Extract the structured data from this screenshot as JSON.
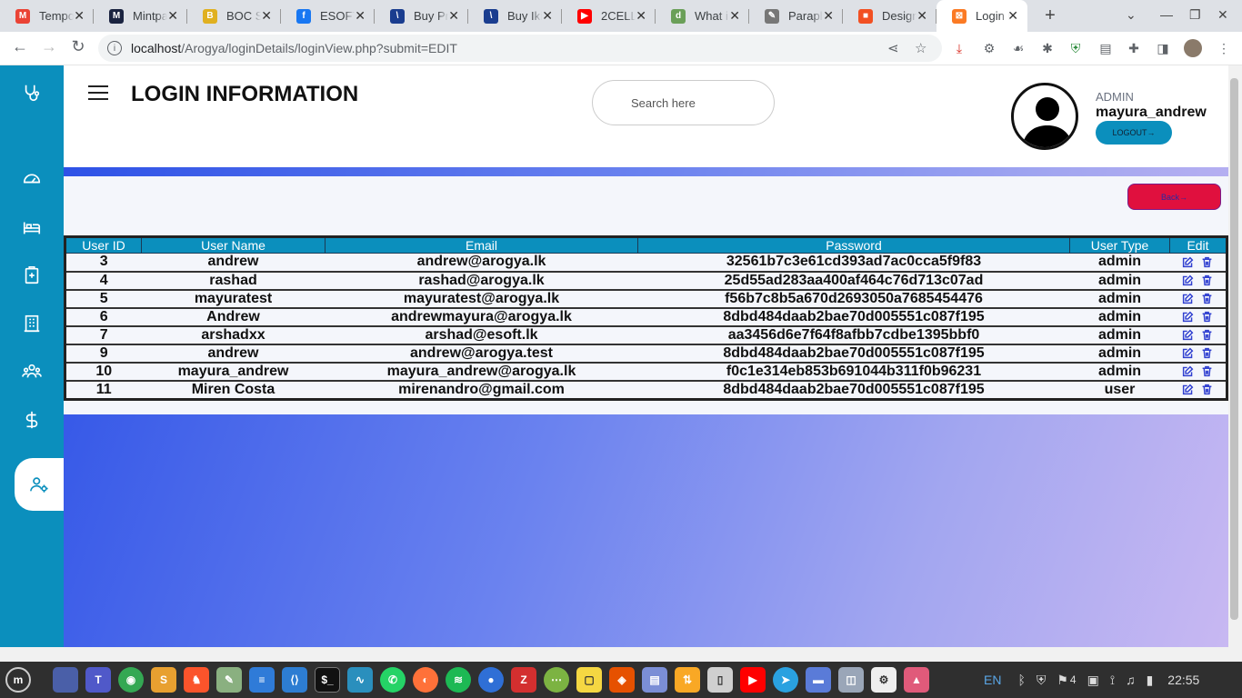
{
  "browser": {
    "tabs": [
      {
        "title": "Tempo",
        "icon": "gmail-icon",
        "color": "#ea4335",
        "glyph": "M"
      },
      {
        "title": "Mintpa",
        "icon": "mintpay-icon",
        "color": "#1a2340",
        "glyph": "M"
      },
      {
        "title": "BOC Sr",
        "icon": "boc-icon",
        "color": "#e0b020",
        "glyph": "B"
      },
      {
        "title": "ESOFT",
        "icon": "facebook-icon",
        "color": "#1877f2",
        "glyph": "f"
      },
      {
        "title": "Buy Pr",
        "icon": "store-icon",
        "color": "#1a3d8f",
        "glyph": "\\"
      },
      {
        "title": "Buy Iki",
        "icon": "store-icon",
        "color": "#1a3d8f",
        "glyph": "\\"
      },
      {
        "title": "2CELL",
        "icon": "youtube-icon",
        "color": "#ff0000",
        "glyph": "▶"
      },
      {
        "title": "What i",
        "icon": "d-icon",
        "color": "#6a9f58",
        "glyph": "d"
      },
      {
        "title": "Parapl",
        "icon": "pen-icon",
        "color": "#777",
        "glyph": "✎"
      },
      {
        "title": "Design",
        "icon": "microsoft-icon",
        "color": "#f25022",
        "glyph": "■"
      },
      {
        "title": "Login I",
        "icon": "xampp-icon",
        "color": "#fb7a24",
        "glyph": "⊠",
        "active": true
      }
    ],
    "url_host": "localhost",
    "url_path": "/Arogya/loginDetails/loginView.php?submit=EDIT"
  },
  "header": {
    "title": "LOGIN INFORMATION",
    "search_placeholder": "Search here",
    "role": "ADMIN",
    "username": "mayura_andrew",
    "logout_label": "LOGOUT→"
  },
  "back_label": "Back→",
  "table": {
    "columns": [
      "User ID",
      "User Name",
      "Email",
      "Password",
      "User Type",
      "Edit"
    ],
    "rows": [
      [
        "3",
        "andrew",
        "andrew@arogya.lk",
        "32561b7c3e61cd393ad7ac0cca5f9f83",
        "admin"
      ],
      [
        "4",
        "rashad",
        "rashad@arogya.lk",
        "25d55ad283aa400af464c76d713c07ad",
        "admin"
      ],
      [
        "5",
        "mayuratest",
        "mayuratest@arogya.lk",
        "f56b7c8b5a670d2693050a7685454476",
        "admin"
      ],
      [
        "6",
        "Andrew",
        "andrewmayura@arogya.lk",
        "8dbd484daab2bae70d005551c087f195",
        "admin"
      ],
      [
        "7",
        "arshadxx",
        "arshad@esoft.lk",
        "aa3456d6e7f64f8afbb7cdbe1395bbf0",
        "admin"
      ],
      [
        "9",
        "andrew",
        "andrew@arogya.test",
        "8dbd484daab2bae70d005551c087f195",
        "admin"
      ],
      [
        "10",
        "mayura_andrew",
        "mayura_andrew@arogya.lk",
        "f0c1e314eb853b691044b311f0b96231",
        "admin"
      ],
      [
        "11",
        "Miren Costa",
        "mirenandro@gmail.com",
        "8dbd484daab2bae70d005551c087f195",
        "user"
      ]
    ]
  },
  "taskbar": {
    "language": "EN",
    "clock": "22:55",
    "badge": "4"
  }
}
